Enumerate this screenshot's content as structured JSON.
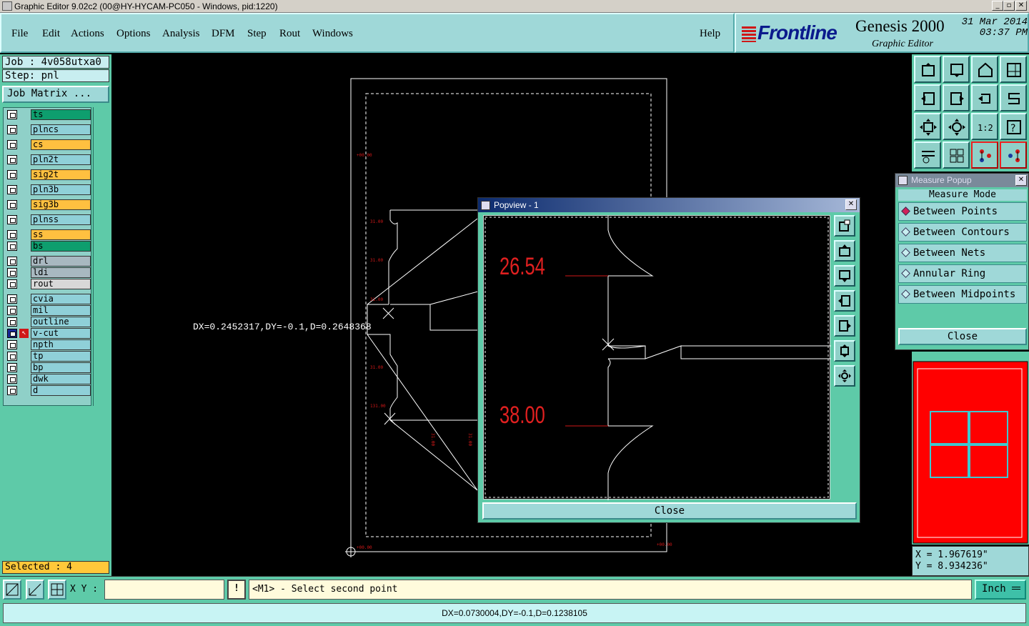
{
  "window": {
    "title": "Graphic Editor 9.02c2 (00@HY-HYCAM-PC050 - Windows, pid:1220)"
  },
  "menu": [
    "File",
    "Edit",
    "Actions",
    "Options",
    "Analysis",
    "DFM",
    "Step",
    "Rout",
    "Windows"
  ],
  "help_label": "Help",
  "brand": {
    "logo": "Frontline",
    "product": "Genesis 2000",
    "subtitle": "Graphic Editor",
    "date": "31 Mar 2014",
    "time": "03:37 PM"
  },
  "job": {
    "job_label": "Job : 4v058utxa0",
    "step_label": "Step: pnl",
    "matrix_button": "Job Matrix ..."
  },
  "layers": [
    {
      "name": "ts",
      "color": "#0e9e6e"
    },
    {
      "name": "plncs",
      "color": "#8fd0d8"
    },
    {
      "name": "cs",
      "color": "#ffc040"
    },
    {
      "name": "pln2t",
      "color": "#8fd0d8"
    },
    {
      "name": "sig2t",
      "color": "#ffc040"
    },
    {
      "name": "pln3b",
      "color": "#8fd0d8"
    },
    {
      "name": "sig3b",
      "color": "#ffc040"
    },
    {
      "name": "plnss",
      "color": "#8fd0d8"
    },
    {
      "name": "ss",
      "color": "#ffc040"
    },
    {
      "name": "bs",
      "color": "#0e9e6e"
    },
    {
      "name": "drl",
      "color": "#a8b8c0"
    },
    {
      "name": "ldi",
      "color": "#a8b8c0"
    },
    {
      "name": "rout",
      "color": "#d8d8d8"
    },
    {
      "name": "cvia",
      "color": "#8fd0d8"
    },
    {
      "name": "mil",
      "color": "#8fd0d8"
    },
    {
      "name": "outline",
      "color": "#8fd0d8"
    },
    {
      "name": "v-cut",
      "color": "#8fd0d8",
      "active": true
    },
    {
      "name": "npth",
      "color": "#8fd0d8"
    },
    {
      "name": "tp",
      "color": "#8fd0d8"
    },
    {
      "name": "bp",
      "color": "#8fd0d8"
    },
    {
      "name": "dwk",
      "color": "#8fd0d8"
    },
    {
      "name": "d",
      "color": "#8fd0d8"
    }
  ],
  "selected": "Selected : 4",
  "canvas": {
    "readout": "DX=0.2452317,DY=-0.1,D=0.2648368"
  },
  "popview": {
    "title": "Popview - 1",
    "label_top": "26.54",
    "label_bottom": "38.00",
    "close": "Close"
  },
  "measure": {
    "title": "Measure Popup",
    "mode_label": "Measure Mode",
    "options": [
      {
        "label": "Between Points",
        "selected": true
      },
      {
        "label": "Between Contours",
        "selected": false
      },
      {
        "label": "Between Nets",
        "selected": false
      },
      {
        "label": "Annular Ring",
        "selected": false
      },
      {
        "label": "Between Midpoints",
        "selected": false
      }
    ],
    "close": "Close"
  },
  "coords": {
    "x": "X = 1.967619\"",
    "y": "Y = 8.934236\""
  },
  "bottom": {
    "xy_label": "X Y :",
    "xy_value": "",
    "bang": "!",
    "prompt": "<M1> - Select second point",
    "unit": "Inch"
  },
  "status": "DX=0.0730004,DY=-0.1,D=0.1238105"
}
